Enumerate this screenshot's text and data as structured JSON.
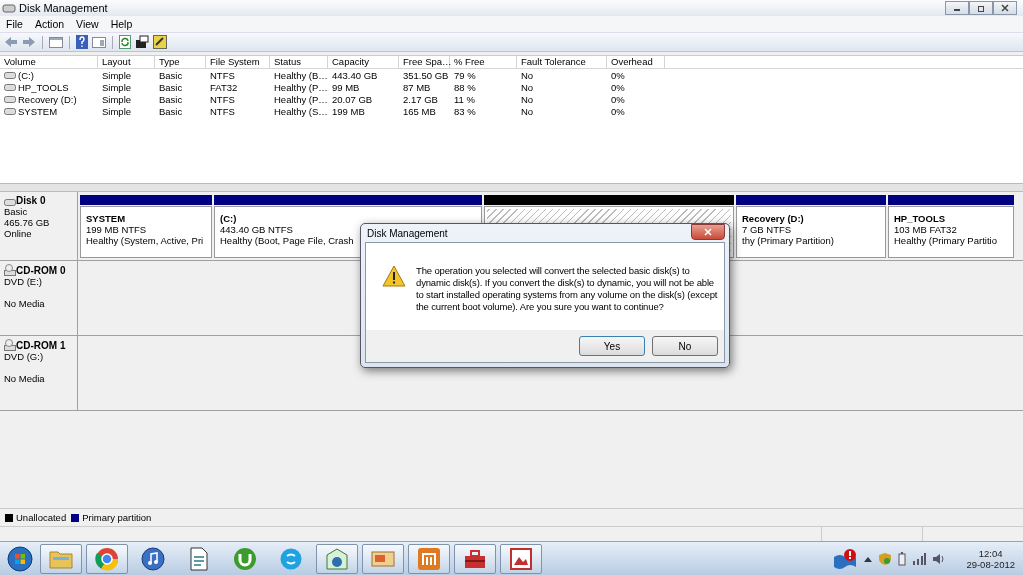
{
  "window": {
    "title": "Disk Management"
  },
  "menu": [
    "File",
    "Action",
    "View",
    "Help"
  ],
  "volumes": {
    "columns": [
      "Volume",
      "Layout",
      "Type",
      "File System",
      "Status",
      "Capacity",
      "Free Spa…",
      "% Free",
      "Fault Tolerance",
      "Overhead"
    ],
    "rows": [
      [
        "(C:)",
        "Simple",
        "Basic",
        "NTFS",
        "Healthy (B…",
        "443.40 GB",
        "351.50 GB",
        "79 %",
        "No",
        "0%"
      ],
      [
        "HP_TOOLS",
        "Simple",
        "Basic",
        "FAT32",
        "Healthy (P…",
        "99 MB",
        "87 MB",
        "88 %",
        "No",
        "0%"
      ],
      [
        "Recovery (D:)",
        "Simple",
        "Basic",
        "NTFS",
        "Healthy (P…",
        "20.07 GB",
        "2.17 GB",
        "11 %",
        "No",
        "0%"
      ],
      [
        "SYSTEM",
        "Simple",
        "Basic",
        "NTFS",
        "Healthy (S…",
        "199 MB",
        "165 MB",
        "83 %",
        "No",
        "0%"
      ]
    ]
  },
  "disks": [
    {
      "kind": "hard_disk",
      "name": "Disk 0",
      "type": "Basic",
      "size": "465.76 GB",
      "status": "Online",
      "partitions": [
        {
          "kind": "primary",
          "title": "SYSTEM",
          "lines": [
            "199 MB NTFS",
            "Healthy (System, Active, Pri"
          ]
        },
        {
          "kind": "primary",
          "title": "(C:)",
          "lines": [
            "443.40 GB NTFS",
            "Healthy (Boot, Page File, Crash"
          ]
        },
        {
          "kind": "unallocated"
        },
        {
          "kind": "primary",
          "title": "Recovery  (D:)",
          "lines": [
            "7 GB NTFS",
            "thy (Primary Partition)"
          ]
        },
        {
          "kind": "primary",
          "title": "HP_TOOLS",
          "lines": [
            "103 MB FAT32",
            "Healthy (Primary Partitio"
          ]
        }
      ]
    },
    {
      "kind": "cd",
      "name": "CD-ROM 0",
      "type": "DVD (E:)",
      "status": "No Media"
    },
    {
      "kind": "cd",
      "name": "CD-ROM 1",
      "type": "DVD (G:)",
      "status": "No Media"
    }
  ],
  "legend": [
    {
      "label": "Unallocated",
      "color": "#000000"
    },
    {
      "label": "Primary partition",
      "color": "#000080"
    }
  ],
  "dialog": {
    "title": "Disk Management",
    "message": "The operation you selected will convert the selected basic disk(s) to dynamic disk(s). If you convert the disk(s) to dynamic, you will not be able to start installed operating systems from any volume on the disk(s) (except the current boot volume). Are you sure you want to continue?",
    "buttons": [
      "Yes",
      "No"
    ]
  },
  "taskbar": {
    "apps": [
      {
        "kind": "folder",
        "running": true
      },
      {
        "kind": "globe",
        "running": true
      },
      {
        "kind": "music",
        "running": false
      },
      {
        "kind": "document",
        "running": false
      },
      {
        "kind": "torrent",
        "running": false
      },
      {
        "kind": "chat",
        "running": false
      },
      {
        "kind": "drive",
        "running": true
      },
      {
        "kind": "slides",
        "running": true
      },
      {
        "kind": "audio",
        "running": true
      },
      {
        "kind": "toolbox",
        "running": true
      },
      {
        "kind": "image",
        "running": true
      }
    ],
    "clock": {
      "time": "12:04",
      "date": "29-08-2012"
    }
  }
}
